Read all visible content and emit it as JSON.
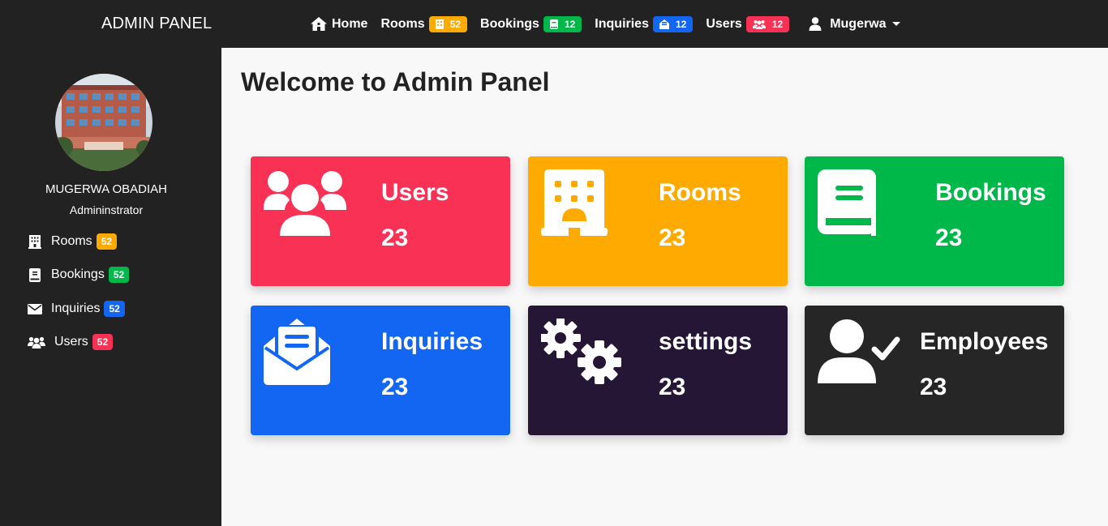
{
  "brand": "ADMIN PANEL",
  "nav": {
    "home": "Home",
    "rooms": {
      "label": "Rooms",
      "badge": "52",
      "color": "#ffaa00"
    },
    "bookings": {
      "label": "Bookings",
      "badge": "12",
      "color": "#00b74a"
    },
    "inquiries": {
      "label": "Inquiries",
      "badge": "12",
      "color": "#1266f1"
    },
    "users": {
      "label": "Users",
      "badge": "12",
      "color": "#f93154"
    },
    "user_menu": "Mugerwa"
  },
  "profile": {
    "name": "MUGERWA OBADIAH",
    "role": "Admininstrator"
  },
  "sidebar": {
    "items": [
      {
        "label": "Rooms",
        "badge": "52",
        "icon": "building-icon",
        "color": "#ffaa00"
      },
      {
        "label": "Bookings",
        "badge": "52",
        "icon": "book-icon",
        "color": "#00b74a"
      },
      {
        "label": "Inquiries",
        "badge": "52",
        "icon": "envelope-icon",
        "color": "#1266f1"
      },
      {
        "label": "Users",
        "badge": "52",
        "icon": "users-icon",
        "color": "#f93154"
      }
    ]
  },
  "main": {
    "title": "Welcome to Admin Panel",
    "cards": [
      {
        "label": "Users",
        "count": "23",
        "icon": "users-icon",
        "color": "#f93154"
      },
      {
        "label": "Rooms",
        "count": "23",
        "icon": "building-icon",
        "color": "#ffaa00"
      },
      {
        "label": "Bookings",
        "count": "23",
        "icon": "book-icon",
        "color": "#00b74a"
      },
      {
        "label": "Inquiries",
        "count": "23",
        "icon": "envelope-open-icon",
        "color": "#1266f1"
      },
      {
        "label": "settings",
        "count": "23",
        "icon": "gears-icon",
        "color": "#261636"
      },
      {
        "label": "Employees",
        "count": "23",
        "icon": "user-check-icon",
        "color": "#262626"
      }
    ]
  }
}
